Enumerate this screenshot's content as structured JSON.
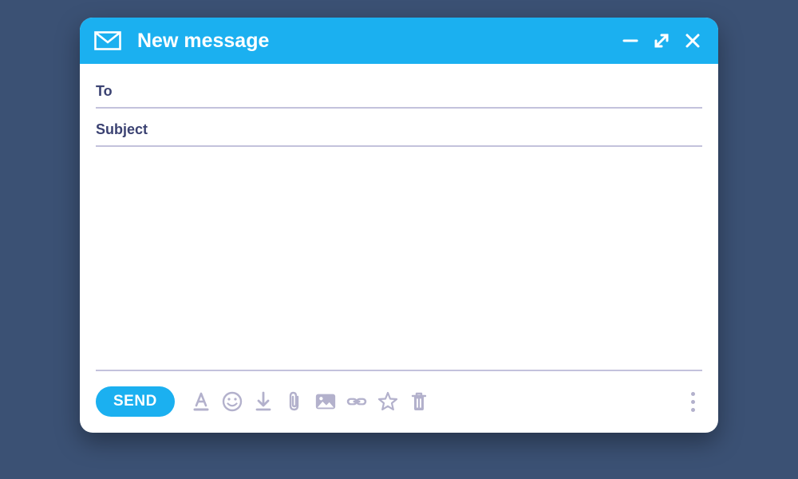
{
  "header": {
    "title": "New message"
  },
  "fields": {
    "to_label": "To",
    "to_value": "",
    "subject_label": "Subject",
    "subject_value": ""
  },
  "message": {
    "body": "",
    "placeholder": ""
  },
  "footer": {
    "send_label": "SEND"
  },
  "icons": {
    "envelope": "envelope-icon",
    "minimize": "minimize-icon",
    "fullscreen": "fullscreen-icon",
    "close": "close-icon",
    "format": "format-text-icon",
    "emoji": "emoji-icon",
    "download": "insert-download-icon",
    "attach": "attach-icon",
    "image": "image-icon",
    "link": "link-icon",
    "star": "star-icon",
    "delete": "delete-icon",
    "more": "more-icon"
  },
  "colors": {
    "accent": "#1bb0f0",
    "background": "#3b5174",
    "muted": "#b3b1cc",
    "label": "#3b4272",
    "divider": "#c3c2dc"
  }
}
